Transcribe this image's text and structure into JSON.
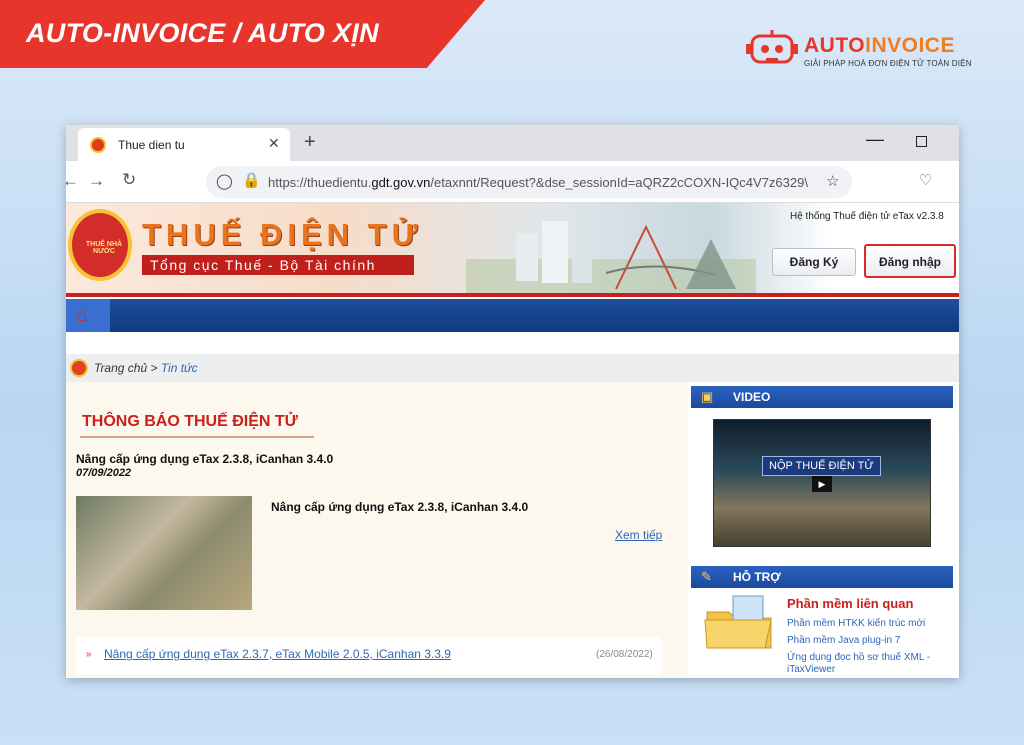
{
  "banner": {
    "title": "AUTO-INVOICE / AUTO XỊN"
  },
  "logo": {
    "brand_a": "AUTO",
    "brand_b": "INVOICE",
    "tagline": "GIẢI PHÁP HOÁ ĐƠN ĐIỆN TỬ TOÀN DIỆN"
  },
  "browser": {
    "tab_title": "Thue dien tu",
    "url_host": "https://thuedientu.",
    "url_domain": "gdt.gov.vn",
    "url_path": "/etaxnnt/Request?&dse_sessionId=aQRZ2cCOXN-IQc4V7z6329\\"
  },
  "site": {
    "emblem_text": "THUẾ NHÀ NƯỚC",
    "title": "THUẾ ĐIỆN TỬ",
    "subtitle": "Tổng cục Thuế - Bộ Tài chính",
    "system_label": "Hệ thống Thuế điện tử eTax v2.3.8",
    "register_button": "Đăng Ký",
    "login_button": "Đăng nhập"
  },
  "breadcrumb": {
    "home": "Trang chủ",
    "sep": " > ",
    "current": "Tin tức"
  },
  "main": {
    "notice_title": "THÔNG BÁO THUẾ ĐIỆN TỬ",
    "post_title": "Nâng cấp ứng dụng eTax 2.3.8, iCanhan 3.4.0",
    "post_date": "07/09/2022",
    "post_summary": "Nâng cấp ứng dụng eTax 2.3.8, iCanhan 3.4.0",
    "read_more": "Xem tiếp",
    "list_item_title": "Nâng cấp ứng dụng eTax 2.3.7, eTax Mobile 2.0.5, iCanhan 3.3.9",
    "list_item_date": "(26/08/2022)"
  },
  "sidebar": {
    "video_heading": "VIDEO",
    "video_caption": "NỘP THUẾ ĐIỆN TỬ",
    "support_heading": "HỖ TRỢ",
    "support_title": "Phần mềm liên quan",
    "links": [
      "Phần mềm HTKK kiến trúc mới",
      "Phần mềm Java plug-in 7",
      "Ứng dụng đọc hồ sơ thuế XML -",
      "iTaxViewer"
    ]
  },
  "colors": {
    "accent": "#e8352b",
    "nav_blue": "#1d4d9b",
    "header_red": "#c8201c"
  }
}
